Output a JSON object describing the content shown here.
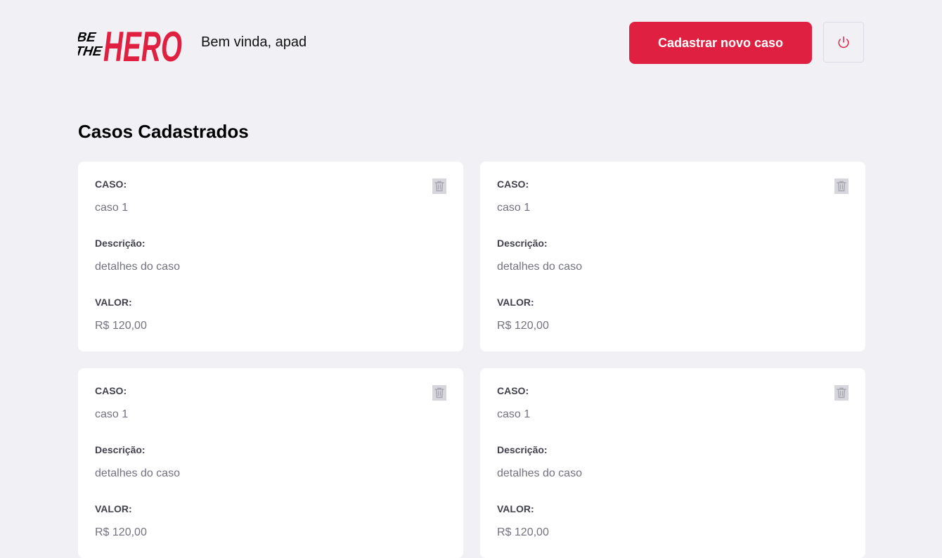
{
  "header": {
    "logo_text": [
      "BE",
      "THE",
      "HERO"
    ],
    "greeting": "Bem vinda, apad",
    "new_case_button": "Cadastrar novo caso",
    "logout_icon": "power-icon"
  },
  "page": {
    "title": "Casos Cadastrados"
  },
  "colors": {
    "accent": "#e02041",
    "background": "#f0f0f5",
    "card": "#ffffff",
    "label": "#41414d",
    "value": "#737380"
  },
  "cases": [
    {
      "case_label": "CASO:",
      "case_value": "caso 1",
      "description_label": "Descrição:",
      "description_value": "detalhes do caso",
      "value_label": "VALOR:",
      "value_value": "R$ 120,00",
      "delete_icon": "trash-icon"
    },
    {
      "case_label": "CASO:",
      "case_value": "caso 1",
      "description_label": "Descrição:",
      "description_value": "detalhes do caso",
      "value_label": "VALOR:",
      "value_value": "R$ 120,00",
      "delete_icon": "trash-icon"
    },
    {
      "case_label": "CASO:",
      "case_value": "caso 1",
      "description_label": "Descrição:",
      "description_value": "detalhes do caso",
      "value_label": "VALOR:",
      "value_value": "R$ 120,00",
      "delete_icon": "trash-icon"
    },
    {
      "case_label": "CASO:",
      "case_value": "caso 1",
      "description_label": "Descrição:",
      "description_value": "detalhes do caso",
      "value_label": "VALOR:",
      "value_value": "R$ 120,00",
      "delete_icon": "trash-icon"
    }
  ]
}
